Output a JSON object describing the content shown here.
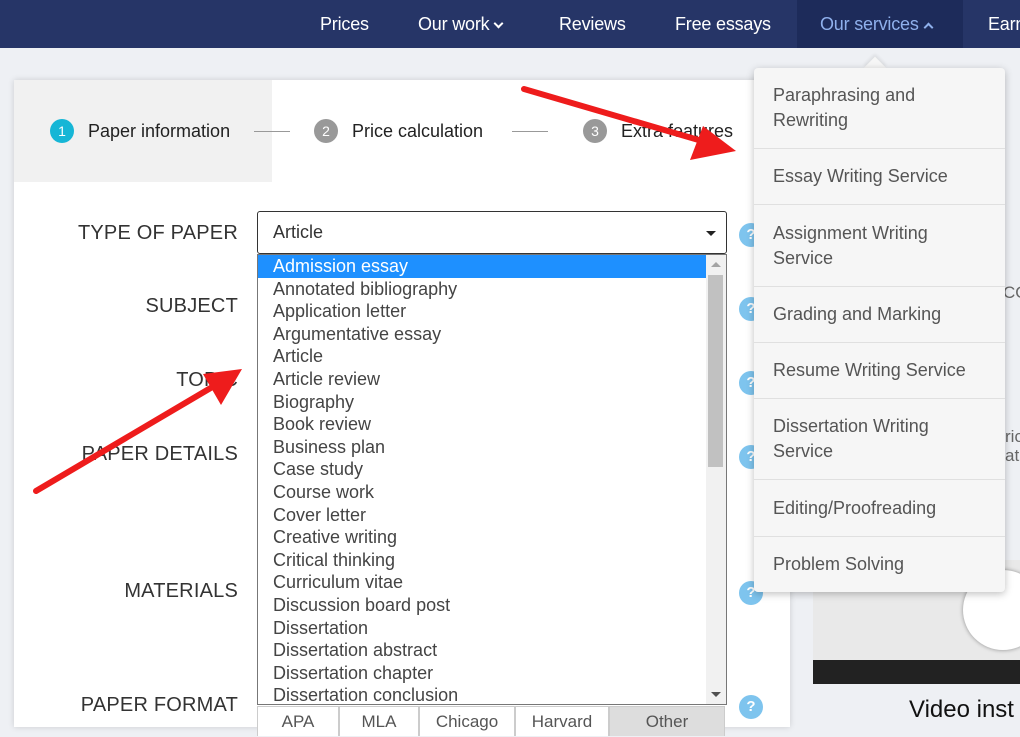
{
  "nav": {
    "items": [
      {
        "label": "Prices"
      },
      {
        "label": "Our work"
      },
      {
        "label": "Reviews"
      },
      {
        "label": "Free essays"
      },
      {
        "label": "Our services"
      },
      {
        "label": "Earn"
      }
    ]
  },
  "steps": [
    {
      "num": "1",
      "label": "Paper information"
    },
    {
      "num": "2",
      "label": "Price calculation"
    },
    {
      "num": "3",
      "label": "Extra features"
    }
  ],
  "form": {
    "labels": {
      "type_of_paper": "TYPE OF PAPER",
      "subject": "SUBJECT",
      "topic": "TOPIC",
      "paper_details": "PAPER DETAILS",
      "materials": "MATERIALS",
      "paper_format": "PAPER FORMAT"
    },
    "help_glyph": "?",
    "type_select_value": "Article",
    "type_options": [
      "Admission essay",
      "Annotated bibliography",
      "Application letter",
      "Argumentative essay",
      "Article",
      "Article review",
      "Biography",
      "Book review",
      "Business plan",
      "Case study",
      "Course work",
      "Cover letter",
      "Creative writing",
      "Critical thinking",
      "Curriculum vitae",
      "Discussion board post",
      "Dissertation",
      "Dissertation abstract",
      "Dissertation chapter",
      "Dissertation conclusion"
    ],
    "format_options": [
      "APA",
      "MLA",
      "Chicago",
      "Harvard",
      "Other"
    ]
  },
  "services_menu": [
    "Paraphrasing and Rewriting",
    "Essay Writing Service",
    "Assignment Writing Service",
    "Grading and Marking",
    "Resume Writing Service",
    "Dissertation Writing Service",
    "Editing/Proofreading",
    "Problem Solving"
  ],
  "side": {
    "partial_1": "CO",
    "partial_2": "ric",
    "partial_3": "at",
    "video_title": "Video inst"
  },
  "colors": {
    "nav_bg": "#263567",
    "nav_active_text": "#8fb0ec",
    "step_active": "#16b6d6",
    "selected_option": "#1e90ff",
    "annotation_arrow": "#ee1c1c"
  }
}
